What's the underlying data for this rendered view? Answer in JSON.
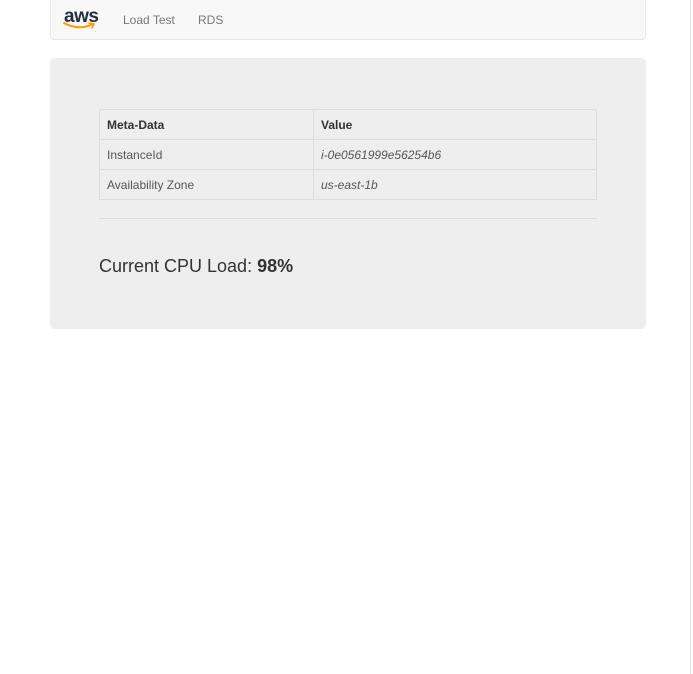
{
  "navbar": {
    "brand": "aws",
    "links": [
      {
        "label": "Load Test"
      },
      {
        "label": "RDS"
      }
    ]
  },
  "metadata_table": {
    "headers": [
      "Meta-Data",
      "Value"
    ],
    "rows": [
      {
        "key": "InstanceId",
        "value": "i-0e0561999e56254b6"
      },
      {
        "key": "Availability Zone",
        "value": "us-east-1b"
      }
    ]
  },
  "cpu": {
    "label": "Current CPU Load:",
    "value": "98%"
  },
  "colors": {
    "navbar_bg": "#f8f8f8",
    "panel_bg": "#eeeeee",
    "aws_text": "#232f3e",
    "aws_smile": "#ff9900"
  }
}
